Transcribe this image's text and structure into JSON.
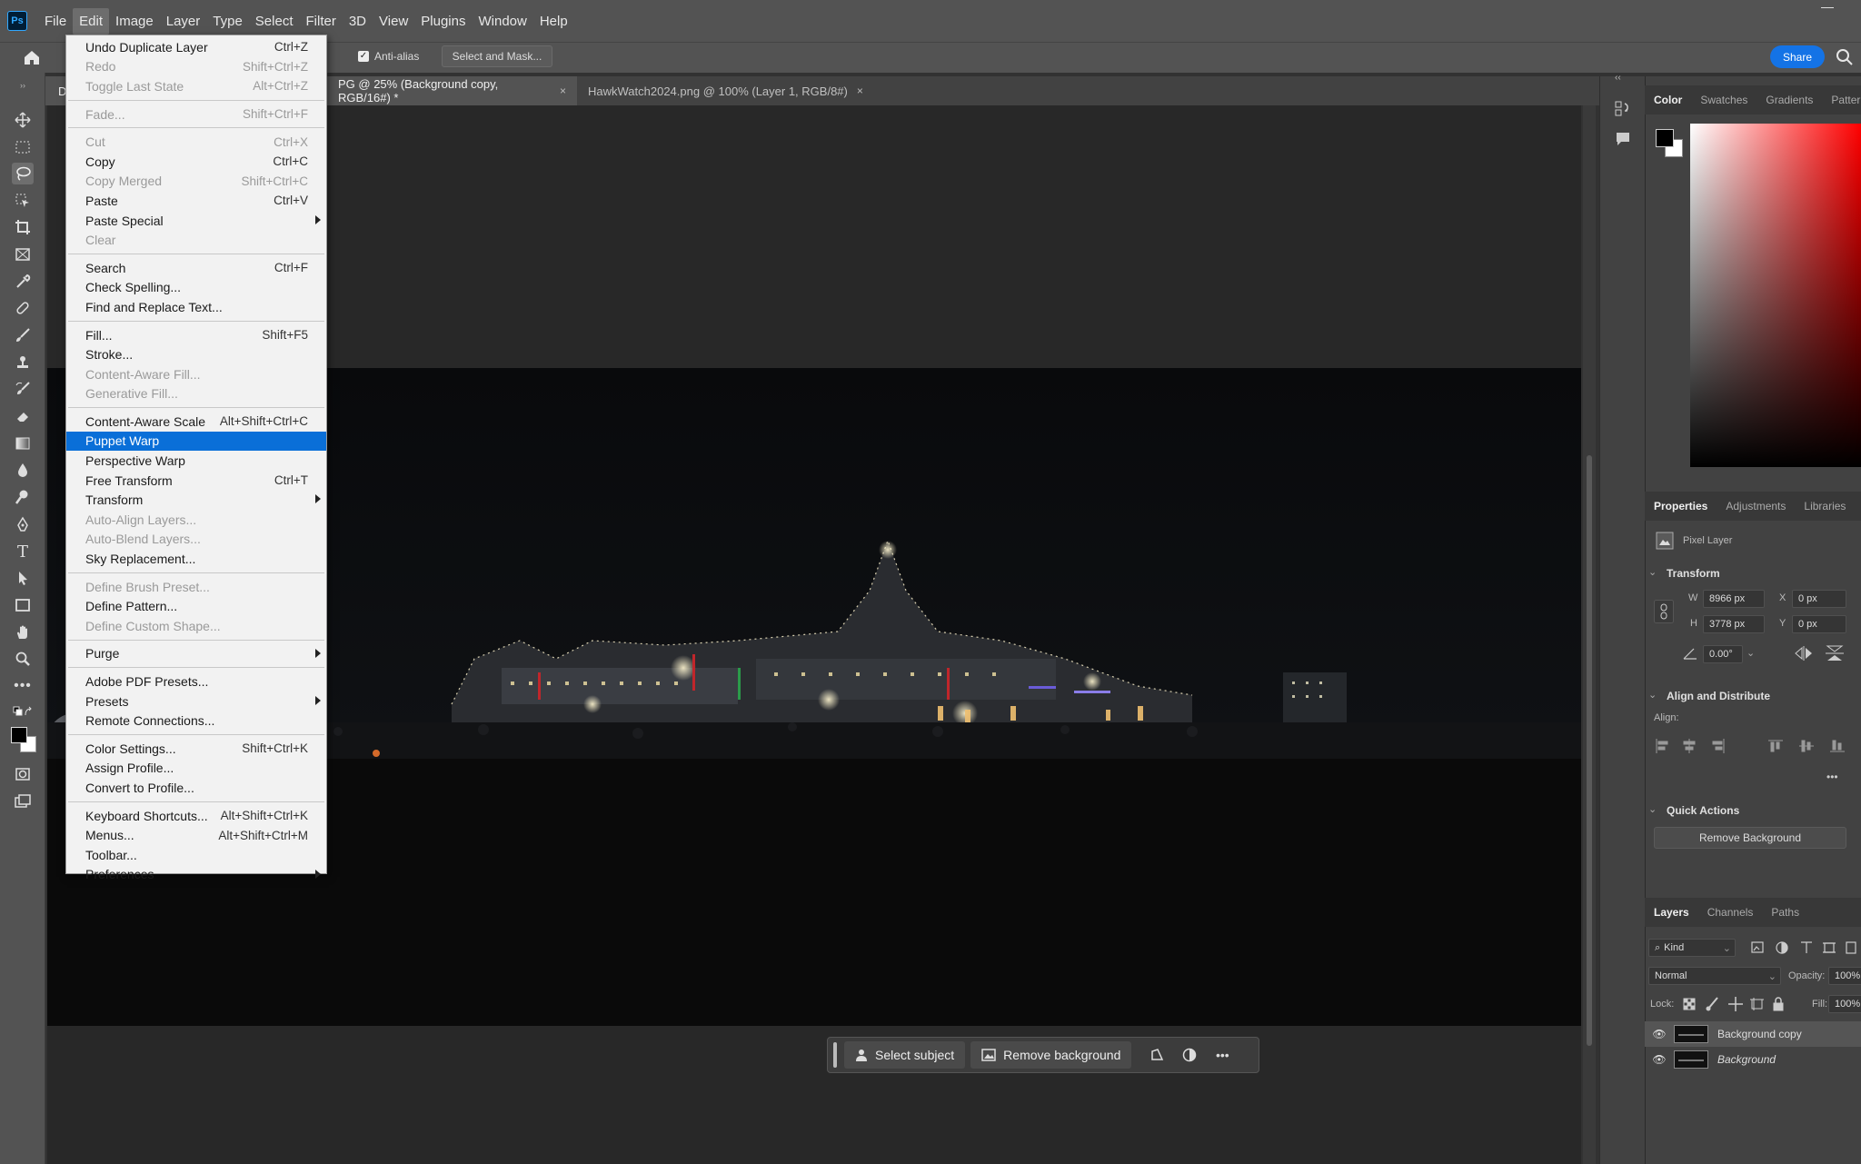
{
  "menubar": {
    "logo": "Ps",
    "items": [
      "File",
      "Edit",
      "Image",
      "Layer",
      "Type",
      "Select",
      "Filter",
      "3D",
      "View",
      "Plugins",
      "Window",
      "Help"
    ]
  },
  "options": {
    "anti_alias_label": "Anti-alias",
    "select_mask_label": "Select and Mask...",
    "share_label": "Share"
  },
  "tabs": {
    "active_fragment": "D",
    "active_label": "PG @ 25% (Background copy, RGB/16#) *",
    "second_label": "HawkWatch2024.png @ 100% (Layer 1, RGB/8#)",
    "close": "×"
  },
  "edit_menu": [
    {
      "label": "Undo Duplicate Layer",
      "shortcut": "Ctrl+Z",
      "disabled": false
    },
    {
      "label": "Redo",
      "shortcut": "Shift+Ctrl+Z",
      "disabled": true
    },
    {
      "label": "Toggle Last State",
      "shortcut": "Alt+Ctrl+Z",
      "disabled": true
    },
    {
      "sep": true
    },
    {
      "label": "Fade...",
      "shortcut": "Shift+Ctrl+F",
      "disabled": true
    },
    {
      "sep": true
    },
    {
      "label": "Cut",
      "shortcut": "Ctrl+X",
      "disabled": true
    },
    {
      "label": "Copy",
      "shortcut": "Ctrl+C",
      "disabled": false
    },
    {
      "label": "Copy Merged",
      "shortcut": "Shift+Ctrl+C",
      "disabled": true
    },
    {
      "label": "Paste",
      "shortcut": "Ctrl+V",
      "disabled": false
    },
    {
      "label": "Paste Special",
      "shortcut": "",
      "disabled": false,
      "submenu": true
    },
    {
      "label": "Clear",
      "shortcut": "",
      "disabled": true
    },
    {
      "sep": true
    },
    {
      "label": "Search",
      "shortcut": "Ctrl+F",
      "disabled": false
    },
    {
      "label": "Check Spelling...",
      "shortcut": "",
      "disabled": false
    },
    {
      "label": "Find and Replace Text...",
      "shortcut": "",
      "disabled": false
    },
    {
      "sep": true
    },
    {
      "label": "Fill...",
      "shortcut": "Shift+F5",
      "disabled": false
    },
    {
      "label": "Stroke...",
      "shortcut": "",
      "disabled": false
    },
    {
      "label": "Content-Aware Fill...",
      "shortcut": "",
      "disabled": true
    },
    {
      "label": "Generative Fill...",
      "shortcut": "",
      "disabled": true
    },
    {
      "sep": true
    },
    {
      "label": "Content-Aware Scale",
      "shortcut": "Alt+Shift+Ctrl+C",
      "disabled": false
    },
    {
      "label": "Puppet Warp",
      "shortcut": "",
      "disabled": false,
      "highlight": true
    },
    {
      "label": "Perspective Warp",
      "shortcut": "",
      "disabled": false
    },
    {
      "label": "Free Transform",
      "shortcut": "Ctrl+T",
      "disabled": false
    },
    {
      "label": "Transform",
      "shortcut": "",
      "disabled": false,
      "submenu": true
    },
    {
      "label": "Auto-Align Layers...",
      "shortcut": "",
      "disabled": true
    },
    {
      "label": "Auto-Blend Layers...",
      "shortcut": "",
      "disabled": true
    },
    {
      "label": "Sky Replacement...",
      "shortcut": "",
      "disabled": false
    },
    {
      "sep": true
    },
    {
      "label": "Define Brush Preset...",
      "shortcut": "",
      "disabled": true
    },
    {
      "label": "Define Pattern...",
      "shortcut": "",
      "disabled": false
    },
    {
      "label": "Define Custom Shape...",
      "shortcut": "",
      "disabled": true
    },
    {
      "sep": true
    },
    {
      "label": "Purge",
      "shortcut": "",
      "disabled": false,
      "submenu": true
    },
    {
      "sep": true
    },
    {
      "label": "Adobe PDF Presets...",
      "shortcut": "",
      "disabled": false
    },
    {
      "label": "Presets",
      "shortcut": "",
      "disabled": false,
      "submenu": true
    },
    {
      "label": "Remote Connections...",
      "shortcut": "",
      "disabled": false
    },
    {
      "sep": true
    },
    {
      "label": "Color Settings...",
      "shortcut": "Shift+Ctrl+K",
      "disabled": false
    },
    {
      "label": "Assign Profile...",
      "shortcut": "",
      "disabled": false
    },
    {
      "label": "Convert to Profile...",
      "shortcut": "",
      "disabled": false
    },
    {
      "sep": true
    },
    {
      "label": "Keyboard Shortcuts...",
      "shortcut": "Alt+Shift+Ctrl+K",
      "disabled": false
    },
    {
      "label": "Menus...",
      "shortcut": "Alt+Shift+Ctrl+M",
      "disabled": false
    },
    {
      "label": "Toolbar...",
      "shortcut": "",
      "disabled": false
    },
    {
      "label": "Preferences",
      "shortcut": "",
      "disabled": false,
      "submenu": true
    }
  ],
  "taskbar": {
    "select_subject": "Select subject",
    "remove_background": "Remove background"
  },
  "color_panel": {
    "tabs": [
      "Color",
      "Swatches",
      "Gradients",
      "Patterns"
    ],
    "active_tab": "Color",
    "foreground": "#000000",
    "background": "#ffffff"
  },
  "properties": {
    "tabs": [
      "Properties",
      "Adjustments",
      "Libraries"
    ],
    "layer_type": "Pixel Layer",
    "transform_title": "Transform",
    "w_label": "W",
    "w_value": "8966 px",
    "h_label": "H",
    "h_value": "3778 px",
    "x_label": "X",
    "x_value": "0 px",
    "y_label": "Y",
    "y_value": "0 px",
    "angle_value": "0.00°",
    "align_title": "Align and Distribute",
    "align_label": "Align:",
    "quick_actions_title": "Quick Actions",
    "remove_background_btn": "Remove Background"
  },
  "layers": {
    "tabs": [
      "Layers",
      "Channels",
      "Paths"
    ],
    "kind_label": "Kind",
    "blend_mode": "Normal",
    "opacity_label": "Opacity:",
    "opacity_value": "100%",
    "lock_label": "Lock:",
    "fill_label": "Fill:",
    "fill_value": "100%",
    "items": [
      {
        "name": "Background copy",
        "selected": true
      },
      {
        "name": "Background",
        "selected": false
      }
    ]
  }
}
